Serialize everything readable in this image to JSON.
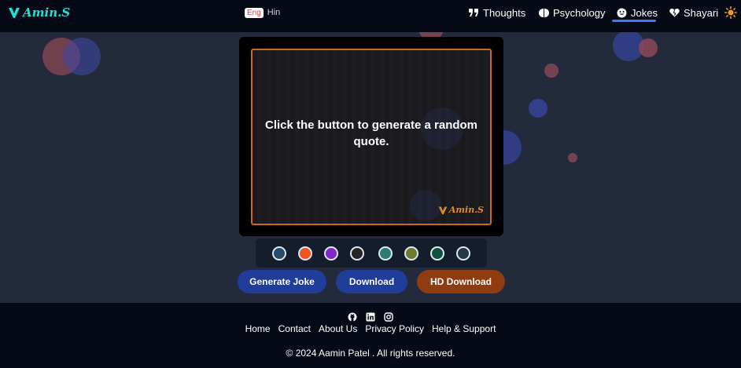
{
  "brand": {
    "name": "Amin.S",
    "color": "#23e0d2"
  },
  "language": {
    "active": "Eng",
    "inactive": "Hin"
  },
  "nav": {
    "items": [
      {
        "label": "Thoughts",
        "icon": "quote-icon"
      },
      {
        "label": "Psychology",
        "icon": "brain-icon"
      },
      {
        "label": "Jokes",
        "icon": "smile-icon",
        "active": true
      },
      {
        "label": "Shayari",
        "icon": "heart-icon"
      }
    ],
    "theme_icon": "sun-icon"
  },
  "card": {
    "quote": "Click the button to generate a random quote.",
    "watermark": "Amin.S",
    "frame_color": "#c96a1c"
  },
  "swatches": [
    "#294a6b",
    "#f05323",
    "#8227c9",
    "#252525",
    "#2d7a72",
    "#707a2e",
    "#0f5242",
    "#223a47"
  ],
  "buttons": {
    "generate": {
      "label": "Generate Joke",
      "color": "#1f3d99"
    },
    "download": {
      "label": "Download",
      "color": "#1f3d99"
    },
    "hd_download": {
      "label": "HD Download",
      "color": "#8f3c10"
    }
  },
  "footer": {
    "icons": [
      "github-icon",
      "linkedin-icon",
      "instagram-icon"
    ],
    "links": [
      "Home",
      "Contact",
      "About Us",
      "Privacy Policy",
      "Help & Support"
    ],
    "copyright": "© 2024 Aamin Patel . All rights reserved."
  }
}
